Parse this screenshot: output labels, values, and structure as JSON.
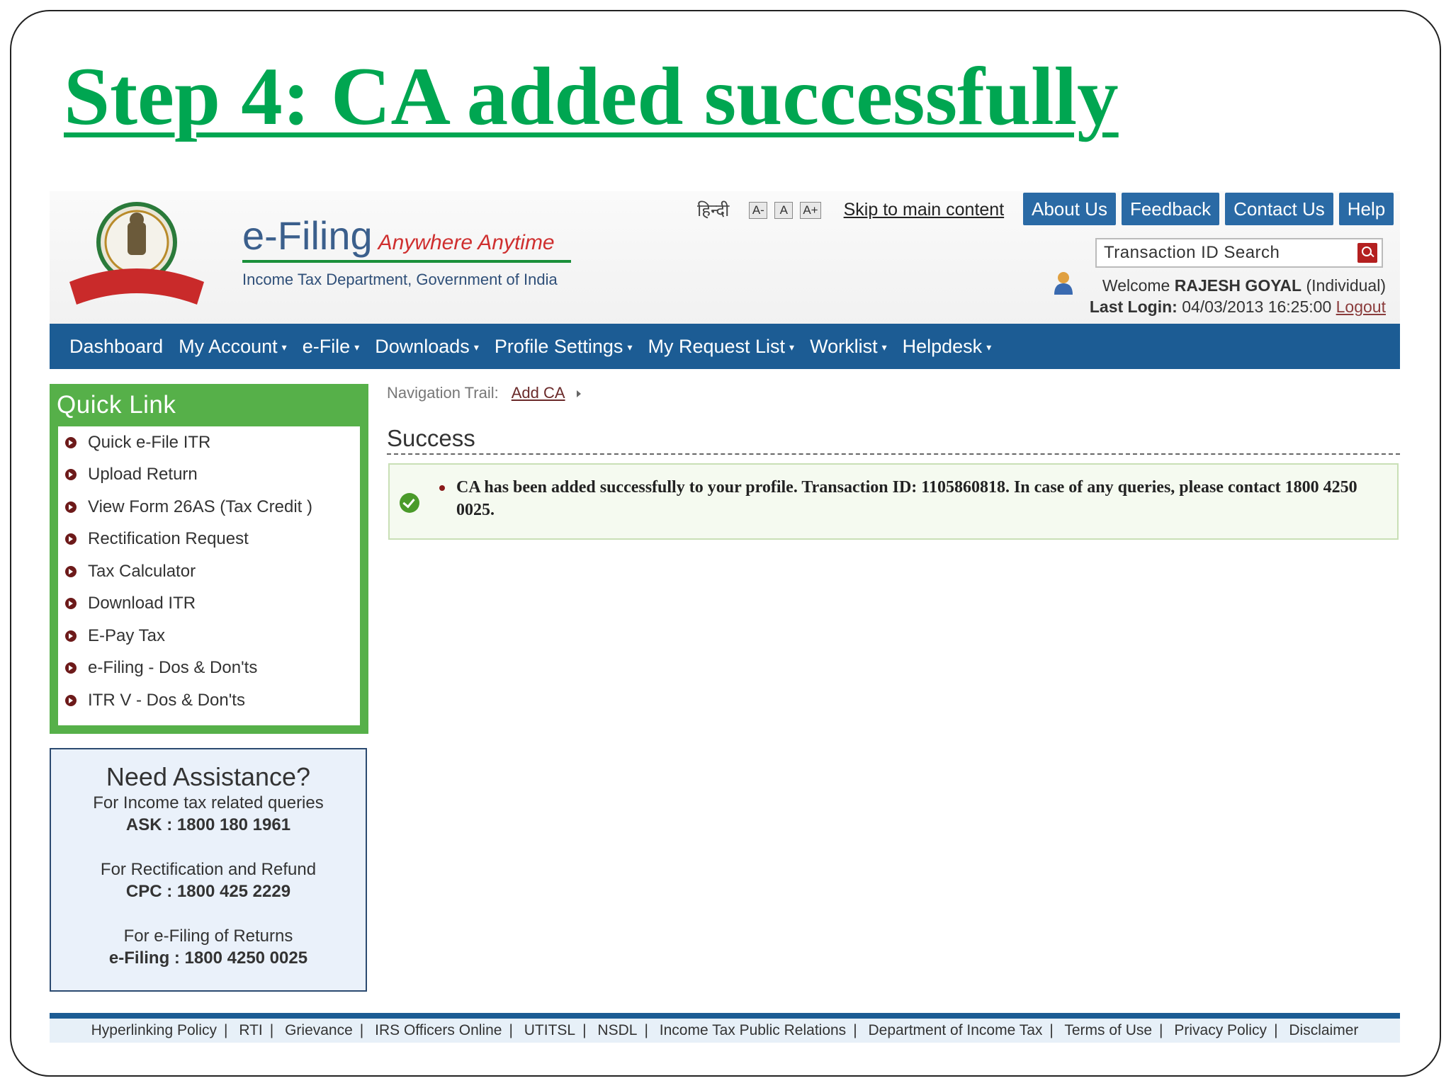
{
  "slide": {
    "title": "Step 4: CA added successfully"
  },
  "header": {
    "brand_main": "e-Filing",
    "brand_tag": "Anywhere Anytime",
    "brand_sub": "Income Tax Department, Government of India",
    "lang": "हिन्दी",
    "font_controls": [
      "A-",
      "A",
      "A+"
    ],
    "skip_link": "Skip to main content",
    "top_nav": [
      "About Us",
      "Feedback",
      "Contact Us",
      "Help"
    ],
    "search_placeholder": "Transaction ID Search",
    "welcome_prefix": "Welcome",
    "user_name": "RAJESH GOYAL",
    "user_type": "(Individual)",
    "last_login_label": "Last Login:",
    "last_login_value": "04/03/2013 16:25:00",
    "logout": "Logout"
  },
  "main_nav": [
    "Dashboard",
    "My Account",
    "e-File",
    "Downloads",
    "Profile Settings",
    "My Request List",
    "Worklist",
    "Helpdesk"
  ],
  "quick_link": {
    "title": "Quick Link",
    "items": [
      "Quick e-File ITR",
      "Upload Return",
      "View Form 26AS (Tax Credit )",
      "Rectification Request",
      "Tax Calculator",
      "Download ITR",
      "E-Pay Tax",
      "e-Filing - Dos & Don'ts",
      "ITR V - Dos & Don'ts"
    ]
  },
  "assistance": {
    "title": "Need Assistance?",
    "blocks": [
      {
        "label": "For Income tax related queries",
        "value": "ASK : 1800 180 1961"
      },
      {
        "label": "For Rectification and Refund",
        "value": "CPC : 1800 425 2229"
      },
      {
        "label": "For e-Filing of Returns",
        "value": "e-Filing : 1800 4250 0025"
      }
    ]
  },
  "content": {
    "trail_label": "Navigation Trail:",
    "trail_link": "Add CA",
    "heading": "Success",
    "message": "CA has been added successfully to your profile. Transaction ID: 1105860818. In case of any queries, please contact 1800 4250 0025."
  },
  "footer": [
    "Hyperlinking Policy",
    "RTI",
    "Grievance",
    "IRS Officers Online",
    "UTITSL",
    "NSDL",
    "Income Tax Public Relations",
    "Department of Income Tax",
    "Terms of Use",
    "Privacy Policy",
    "Disclaimer"
  ],
  "colors": {
    "title_green": "#00a651",
    "nav_blue": "#1c5c94",
    "quick_green": "#56b049"
  }
}
